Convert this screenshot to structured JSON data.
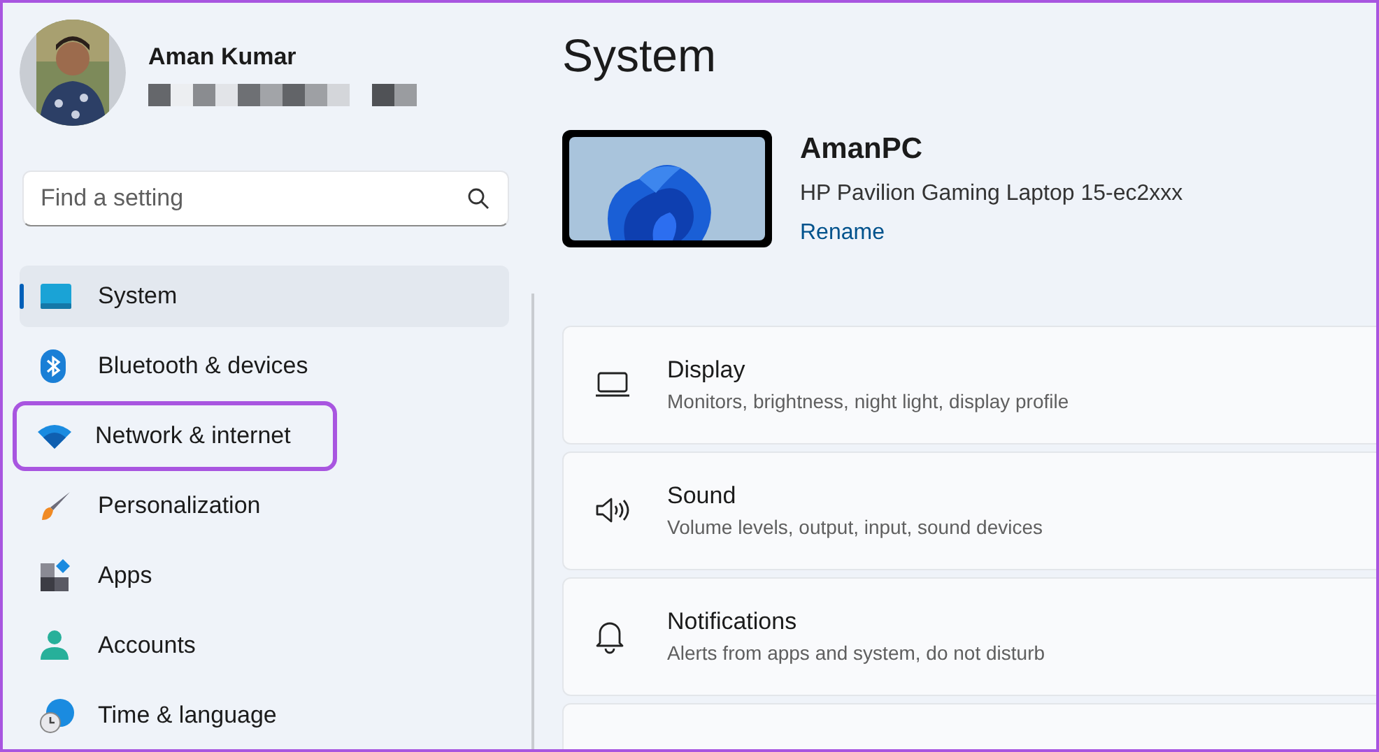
{
  "user": {
    "name": "Aman Kumar"
  },
  "search": {
    "placeholder": "Find a setting"
  },
  "nav": [
    {
      "label": "System",
      "kind": "system",
      "selected": true,
      "highlighted": false
    },
    {
      "label": "Bluetooth & devices",
      "kind": "bluetooth",
      "selected": false,
      "highlighted": false
    },
    {
      "label": "Network & internet",
      "kind": "network",
      "selected": false,
      "highlighted": true
    },
    {
      "label": "Personalization",
      "kind": "brush",
      "selected": false,
      "highlighted": false
    },
    {
      "label": "Apps",
      "kind": "apps",
      "selected": false,
      "highlighted": false
    },
    {
      "label": "Accounts",
      "kind": "accounts",
      "selected": false,
      "highlighted": false
    },
    {
      "label": "Time & language",
      "kind": "time",
      "selected": false,
      "highlighted": false
    }
  ],
  "page_title": "System",
  "device": {
    "name": "AmanPC",
    "model": "HP Pavilion Gaming Laptop 15-ec2xxx",
    "rename_link": "Rename"
  },
  "cards": [
    {
      "kind": "display",
      "title": "Display",
      "subtitle": "Monitors, brightness, night light, display profile"
    },
    {
      "kind": "sound",
      "title": "Sound",
      "subtitle": "Volume levels, output, input, sound devices"
    },
    {
      "kind": "notifications",
      "title": "Notifications",
      "subtitle": "Alerts from apps and system, do not disturb"
    },
    {
      "kind": "blank"
    }
  ]
}
